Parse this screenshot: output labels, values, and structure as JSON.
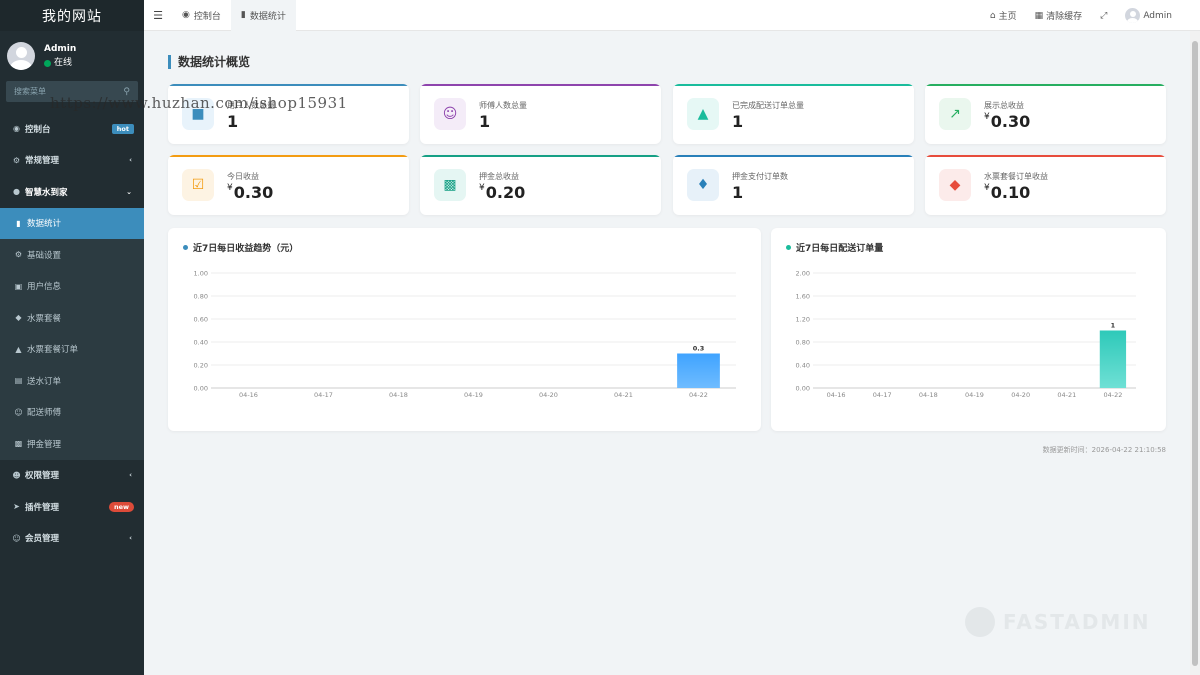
{
  "brand": "我的网站",
  "user": {
    "name": "Admin",
    "status": "在线"
  },
  "search": {
    "placeholder": "搜索菜单"
  },
  "menu": {
    "dashboard": "控制台",
    "dashboard_badge": "hot",
    "general": "常规管理",
    "smart": "智慧水到家",
    "sub": [
      "数据统计",
      "基础设置",
      "用户信息",
      "水票套餐",
      "水票套餐订单",
      "送水订单",
      "配送师傅",
      "押金管理"
    ],
    "auth": "权限管理",
    "addon": "插件管理",
    "addon_badge": "new",
    "member": "会员管理"
  },
  "header": {
    "tabs": [
      "控制台",
      "数据统计"
    ],
    "home": "主页",
    "clear_cache": "清除缓存",
    "admin": "Admin"
  },
  "page": {
    "title": "数据统计概览",
    "updated": "数据更新时间：2026-04-22 21:10:58"
  },
  "cards": [
    {
      "label": "用户人数总量",
      "value": "1",
      "currency": "",
      "color": "#3c8dbc",
      "bg": "#e8f3fb"
    },
    {
      "label": "师傅人数总量",
      "value": "1",
      "currency": "",
      "color": "#8e44ad",
      "bg": "#f4ecf8"
    },
    {
      "label": "已完成配送订单总量",
      "value": "1",
      "currency": "",
      "color": "#1abc9c",
      "bg": "#e6f8f5"
    },
    {
      "label": "展示总收益",
      "value": "0.30",
      "currency": "¥",
      "color": "#27ae60",
      "bg": "#eaf7ee"
    },
    {
      "label": "今日收益",
      "value": "0.30",
      "currency": "¥",
      "color": "#f39c12",
      "bg": "#fdf3e3"
    },
    {
      "label": "押金总收益",
      "value": "0.20",
      "currency": "¥",
      "color": "#16a085",
      "bg": "#e5f6f3"
    },
    {
      "label": "押金支付订单数",
      "value": "1",
      "currency": "",
      "color": "#2980b9",
      "bg": "#e7f1f9"
    },
    {
      "label": "水票套餐订单收益",
      "value": "0.10",
      "currency": "¥",
      "color": "#e74c3c",
      "bg": "#fcebea"
    }
  ],
  "watermark": "https://www.huzhan.com/ishop15931",
  "logo_text": "FASTADMIN",
  "chart_data": [
    {
      "type": "bar",
      "title": "近7日每日收益趋势（元）",
      "categories": [
        "04-16",
        "04-17",
        "04-18",
        "04-19",
        "04-20",
        "04-21",
        "04-22"
      ],
      "values": [
        0,
        0,
        0,
        0,
        0,
        0,
        0.3
      ],
      "ylim": [
        0,
        1
      ],
      "yticks": [
        "0.00",
        "0.20",
        "0.40",
        "0.60",
        "0.80",
        "1.00"
      ],
      "data_labels": [
        "",
        "",
        "",
        "",
        "",
        "",
        "0.3"
      ],
      "color_top": "#3fa3ff",
      "color_bottom": "#6fbcff",
      "dot_color": "#3c8dbc",
      "grid": true
    },
    {
      "type": "bar",
      "title": "近7日每日配送订单量",
      "categories": [
        "04-16",
        "04-17",
        "04-18",
        "04-19",
        "04-20",
        "04-21",
        "04-22"
      ],
      "values": [
        0,
        0,
        0,
        0,
        0,
        0,
        1
      ],
      "ylim": [
        0,
        2
      ],
      "yticks": [
        "0.00",
        "0.40",
        "0.80",
        "1.20",
        "1.60",
        "2.00"
      ],
      "data_labels": [
        "",
        "",
        "",
        "",
        "",
        "",
        "1"
      ],
      "color_top": "#2ec9b9",
      "color_bottom": "#6fe0d5",
      "dot_color": "#1abc9c",
      "grid": true
    }
  ]
}
